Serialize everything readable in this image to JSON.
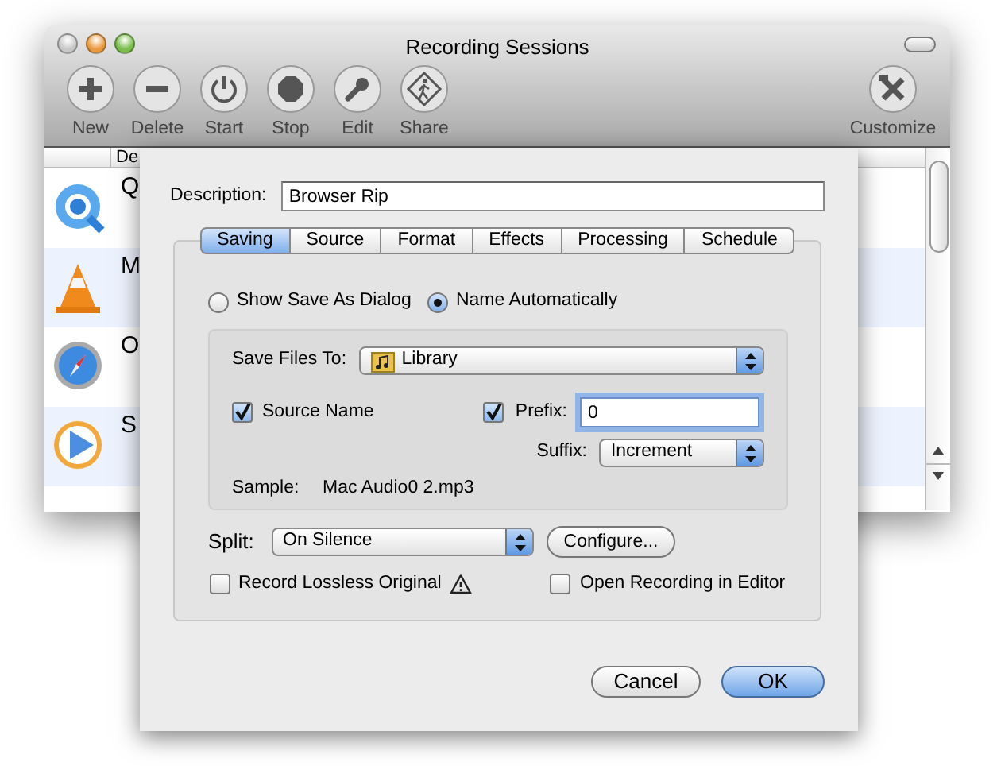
{
  "window": {
    "title": "Recording Sessions"
  },
  "toolbar": [
    {
      "label": "New",
      "kind": "plus"
    },
    {
      "label": "Delete",
      "kind": "minus"
    },
    {
      "label": "Start",
      "kind": "power"
    },
    {
      "label": "Stop",
      "kind": "stop"
    },
    {
      "label": "Edit",
      "kind": "wrench"
    },
    {
      "label": "Share",
      "kind": "walker"
    },
    {
      "label": "Customize",
      "kind": "tools"
    }
  ],
  "table": {
    "columns": [
      "De"
    ],
    "rows": [
      {
        "name": "Q",
        "kind": "ring"
      },
      {
        "name": "M",
        "kind": "cone"
      },
      {
        "name": "O",
        "kind": "compass"
      },
      {
        "name": "S",
        "kind": "play"
      }
    ]
  },
  "sheet": {
    "description_label": "Description:",
    "description": "Browser Rip",
    "tabs": [
      {
        "label": "Saving",
        "selected": true
      },
      {
        "label": "Source",
        "selected": false
      },
      {
        "label": "Format",
        "selected": false
      },
      {
        "label": "Effects",
        "selected": false
      },
      {
        "label": "Processing",
        "selected": false
      },
      {
        "label": "Schedule",
        "selected": false
      }
    ],
    "save_mode": [
      {
        "label": "Show Save As Dialog",
        "selected": false
      },
      {
        "label": "Name Automatically",
        "selected": true
      }
    ],
    "save_files_to": {
      "label": "Save Files To:",
      "value": "Library"
    },
    "source_name": {
      "label": "Source Name",
      "checked": true
    },
    "prefix": {
      "label": "Prefix:",
      "checked": true,
      "value": "0"
    },
    "suffix": {
      "label": "Suffix:",
      "value": "Increment"
    },
    "sample": {
      "label": "Sample:",
      "value": "Mac Audio0 2.mp3"
    },
    "split": {
      "label": "Split:",
      "value": "On Silence",
      "button": "Configure..."
    },
    "record_lossless": {
      "label": "Record Lossless Original",
      "checked": false
    },
    "open_in_editor": {
      "label": "Open Recording in Editor",
      "checked": false
    },
    "buttons": [
      {
        "label": "Cancel",
        "default": false
      },
      {
        "label": "OK",
        "default": true
      }
    ]
  }
}
